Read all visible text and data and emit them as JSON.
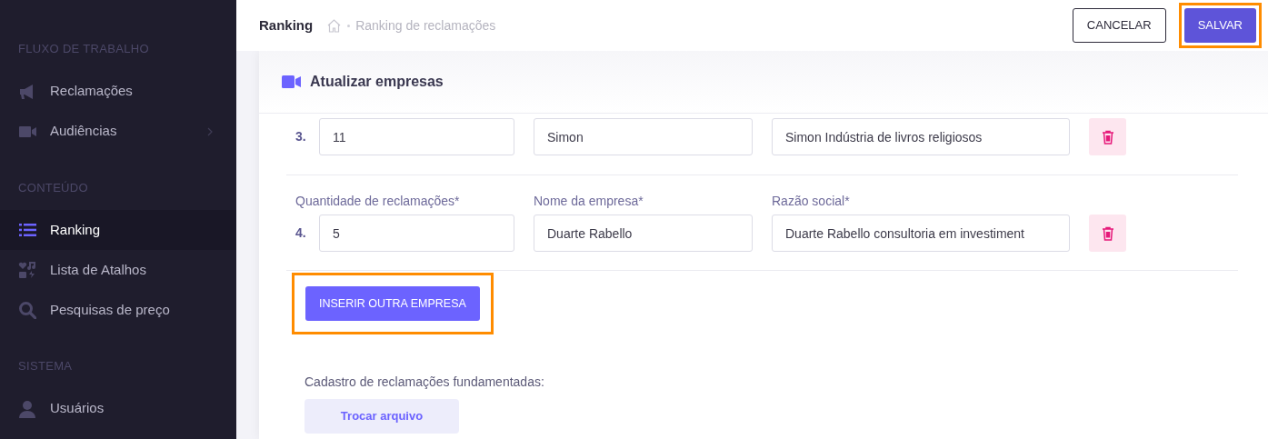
{
  "sidebar": {
    "sections": [
      {
        "title": "FLUXO DE TRABALHO",
        "items": [
          {
            "label": "Reclamações",
            "kind": "megaphone",
            "selected": false,
            "expandable": false
          },
          {
            "label": "Audiências",
            "kind": "video",
            "selected": false,
            "expandable": true
          }
        ]
      },
      {
        "title": "CONTEÚDO",
        "items": [
          {
            "label": "Ranking",
            "kind": "list",
            "selected": true,
            "expandable": false
          },
          {
            "label": "Lista de Atalhos",
            "kind": "shortcuts",
            "selected": false,
            "expandable": false
          },
          {
            "label": "Pesquisas de preço",
            "kind": "search",
            "selected": false,
            "expandable": false
          }
        ]
      },
      {
        "title": "SISTEMA",
        "items": [
          {
            "label": "Usuários",
            "kind": "user",
            "selected": false,
            "expandable": false
          }
        ]
      }
    ]
  },
  "header": {
    "title": "Ranking",
    "breadcrumb": "Ranking de reclamações",
    "buttons": [
      {
        "label": "CANCELAR",
        "kind": "outline",
        "highlighted": false
      },
      {
        "label": "SALVAR",
        "kind": "primary",
        "highlighted": true
      }
    ]
  },
  "card": {
    "title": "Atualizar empresas",
    "rows": [
      {
        "number": "3.",
        "values": [
          "11",
          "Simon",
          "Simon Indústria de livros religiosos"
        ]
      },
      {
        "number": "4.",
        "labels": [
          "Quantidade de reclamações*",
          "Nome da empresa*",
          "Razão social*"
        ],
        "values": [
          "5",
          "Duarte Rabello",
          "Duarte Rabello consultoria em investiment"
        ]
      }
    ],
    "add_button": {
      "label": "INSERIR OUTRA EMPRESA",
      "highlighted": true
    },
    "file_label": "Cadastro de reclamações fundamentadas:",
    "file_button": {
      "label": "Trocar arquivo",
      "highlighted": false
    }
  }
}
